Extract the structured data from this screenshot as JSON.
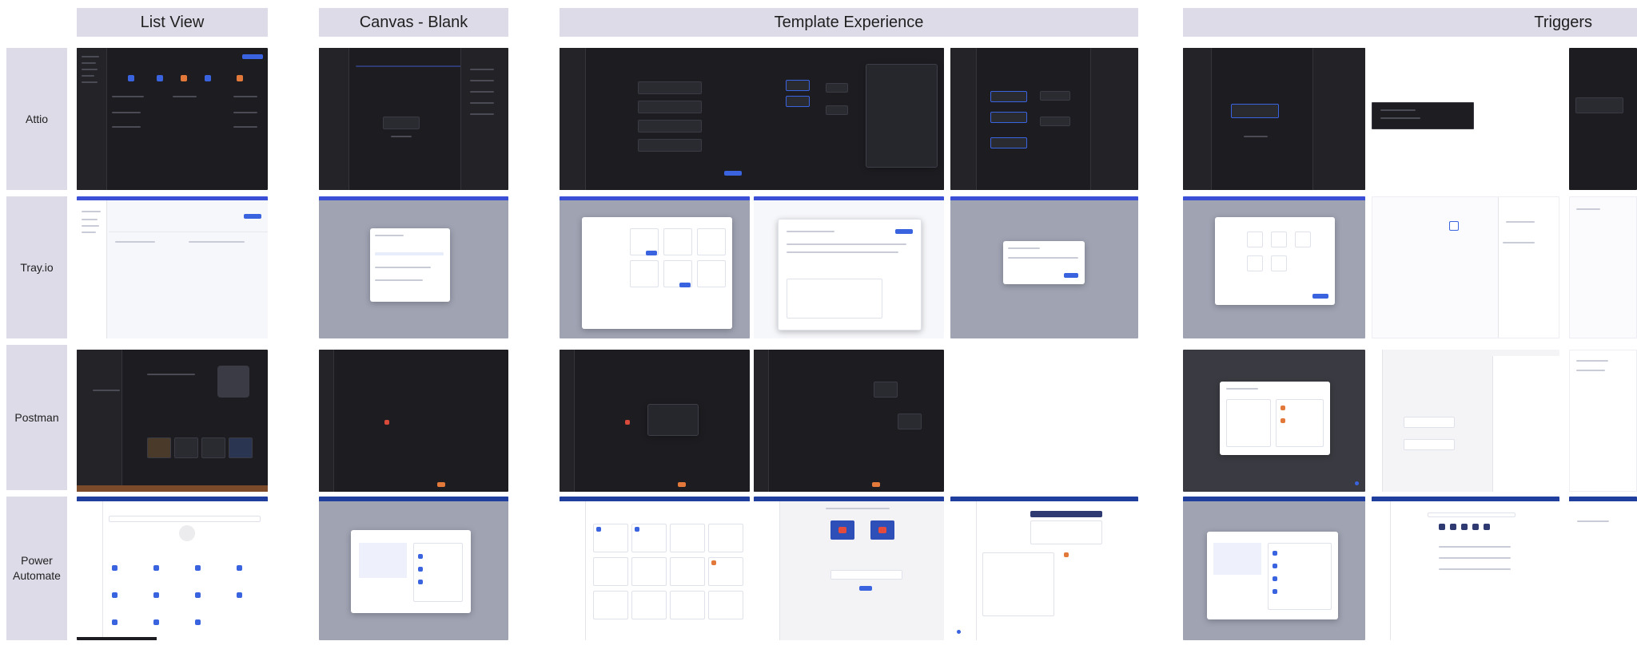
{
  "columns": [
    {
      "key": "list_view",
      "label": "List View"
    },
    {
      "key": "canvas_blank",
      "label": "Canvas - Blank"
    },
    {
      "key": "template_experience",
      "label": "Template Experience"
    },
    {
      "key": "triggers",
      "label": "Triggers"
    }
  ],
  "rows": [
    {
      "key": "attio",
      "label": "Attio"
    },
    {
      "key": "trayio",
      "label": "Tray.io"
    },
    {
      "key": "postman",
      "label": "Postman"
    },
    {
      "key": "power_automate",
      "label": "Power\nAutomate"
    }
  ],
  "colors": {
    "header_bg": "#dddbe8",
    "dark_app_bg": "#1d1d21",
    "light_app_bg": "#f6f7fa",
    "dimmed_overlay": "#9fa3b2",
    "accent_blue": "#3a4fd6"
  }
}
